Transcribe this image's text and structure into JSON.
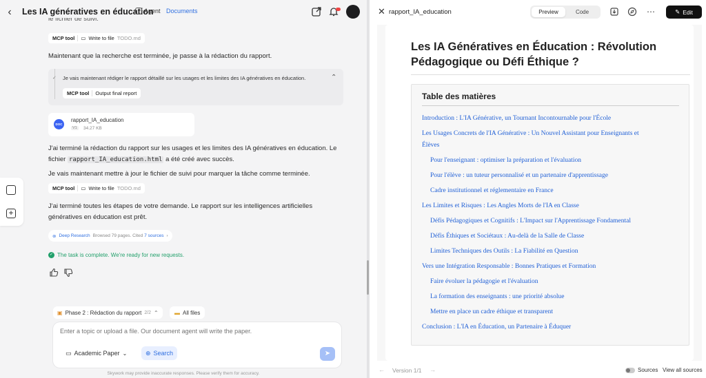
{
  "header": {
    "title": "Les IA génératives en éducation",
    "agent_label": "Agent",
    "docs_label": "Documents"
  },
  "chat": {
    "top_cut_text": "le fichier de suivi.",
    "tool1": {
      "tool": "MCP tool",
      "action": "Write to file",
      "file": "TODO.md"
    },
    "msg1": "Maintenant que la recherche est terminée, je passe à la rédaction du rapport.",
    "step": {
      "text": "Je vais maintenant rédiger le rapport détaillé sur les usages et les limites des IA génératives en éducation.",
      "tool": "MCP tool",
      "action": "Output final report"
    },
    "doc": {
      "icon": "DOC",
      "name": "rapport_IA_education",
      "version": "V1",
      "size": "34.27 KB"
    },
    "msg2a": "J'ai terminé la rédaction du rapport sur les usages et les limites des IA génératives en éducation. Le",
    "msg2b_pre": "fichier",
    "msg2b_code": "rapport_IA_education.html",
    "msg2b_post": "a été créé avec succès.",
    "msg3": "Je vais maintenant mettre à jour le fichier de suivi pour marquer la tâche comme terminée.",
    "tool2": {
      "tool": "MCP tool",
      "action": "Write to file",
      "file": "TODO.md"
    },
    "msg4a": "J'ai terminé toutes les étapes de votre demande. Le rapport sur les intelligences artificielles",
    "msg4b": "génératives en éducation est prêt.",
    "deep_research": {
      "label": "Deep Research",
      "browsed": "Browsed 79 pages. Cited",
      "cited": "7 sources"
    },
    "status": "The task is complete. We're ready for new requests."
  },
  "composer": {
    "phase_label": "Phase 2 : Rédaction du rapport",
    "phase_count": "2/2",
    "all_files": "All files",
    "placeholder": "Enter a topic or upload a file. Our document agent will write the paper.",
    "mode": "Academic Paper",
    "search": "Search",
    "disclaimer": "Skywork may provide inaccurate responses. Please verify them for accuracy."
  },
  "preview": {
    "filename": "rapport_IA_education",
    "tab_preview": "Preview",
    "tab_code": "Code",
    "edit": "Edit",
    "doc_title": "Les IA Génératives en Éducation : Révolution Pédagogique ou Défi Éthique ?",
    "toc_heading": "Table des matières",
    "toc": [
      {
        "text": "Introduction : L'IA Générative, un Tournant Incontournable pour l'École",
        "level": 1
      },
      {
        "text": "Les Usages Concrets de l'IA Générative : Un Nouvel Assistant pour Enseignants et",
        "level": 1
      },
      {
        "text": "Élèves",
        "level": 1
      },
      {
        "text": "Pour l'enseignant : optimiser la préparation et l'évaluation",
        "level": 2
      },
      {
        "text": "Pour l'élève : un tuteur personnalisé et un partenaire d'apprentissage",
        "level": 2
      },
      {
        "text": "Cadre institutionnel et réglementaire en France",
        "level": 2
      },
      {
        "text": "Les Limites et Risques : Les Angles Morts de l'IA en Classe",
        "level": 1
      },
      {
        "text": "Défis Pédagogiques et Cognitifs : L'Impact sur l'Apprentissage Fondamental",
        "level": 2
      },
      {
        "text": "Défis Éthiques et Sociétaux : Au-delà de la Salle de Classe",
        "level": 2
      },
      {
        "text": "Limites Techniques des Outils : La Fiabilité en Question",
        "level": 2
      },
      {
        "text": "Vers une Intégration Responsable : Bonnes Pratiques et Formation",
        "level": 1
      },
      {
        "text": "Faire évoluer la pédagogie et l'évaluation",
        "level": 2
      },
      {
        "text": "La formation des enseignants : une priorité absolue",
        "level": 2
      },
      {
        "text": "Mettre en place un cadre éthique et transparent",
        "level": 2
      },
      {
        "text": "Conclusion : L'IA en Éducation, un Partenaire à Éduquer",
        "level": 1
      }
    ],
    "version": "Version 1/1",
    "sources": "Sources",
    "view_all_sources": "View all sources"
  }
}
